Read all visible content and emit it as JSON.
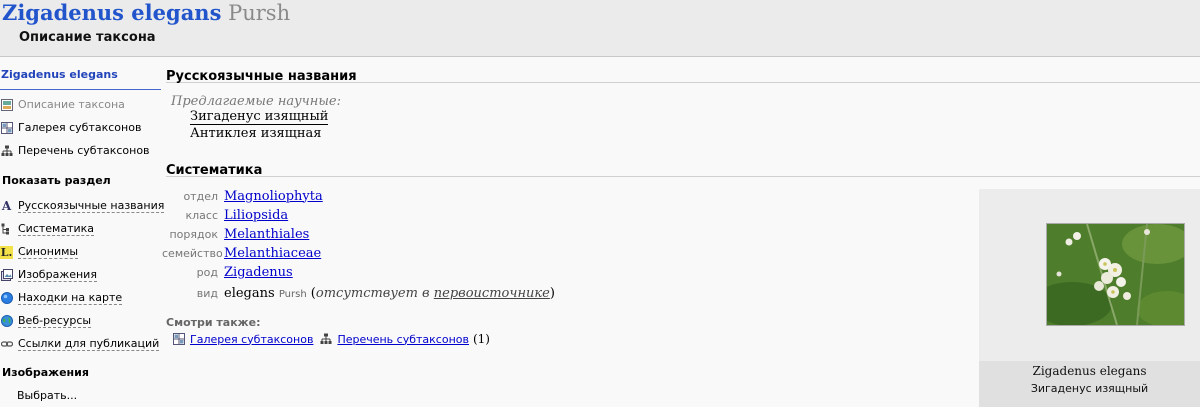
{
  "header": {
    "latin_name": "Zigadenus elegans",
    "author": "Pursh",
    "subtitle": "Описание таксона"
  },
  "sidebar": {
    "taxon_link": "Zigadenus elegans",
    "nav": [
      {
        "label": "Описание таксона",
        "icon": "description-icon"
      },
      {
        "label": "Галерея субтаксонов",
        "icon": "gallery-grid-icon"
      },
      {
        "label": "Перечень субтаксонов",
        "icon": "tree-hierarchy-icon"
      }
    ],
    "show_section_title": "Показать раздел",
    "sections": [
      {
        "label": "Русскоязычные названия",
        "icon": "letter-a-icon"
      },
      {
        "label": "Систематика",
        "icon": "systematics-tree-icon"
      },
      {
        "label": "Синонимы",
        "icon": "letter-l-icon"
      },
      {
        "label": "Изображения",
        "icon": "images-icon"
      },
      {
        "label": "Находки на карте",
        "icon": "globe-blue-icon"
      },
      {
        "label": "Веб-ресурсы",
        "icon": "globe-green-icon"
      },
      {
        "label": "Ссылки для публикаций",
        "icon": "chain-link-icon"
      }
    ],
    "images_title": "Изображения",
    "choose_label": "Выбрать..."
  },
  "main": {
    "russian_names_title": "Русскоязычные названия",
    "proposed_label": "Предлагаемые научные:",
    "russian_names": [
      "Зигаденус изящный",
      "Антиклея изящная"
    ],
    "systematics_title": "Систематика",
    "taxonomy": [
      {
        "rank": "отдел",
        "value": "Magnoliophyta"
      },
      {
        "rank": "класс",
        "value": "Liliopsida"
      },
      {
        "rank": "порядок",
        "value": "Melanthiales"
      },
      {
        "rank": "семейство",
        "value": "Melanthiaceae"
      },
      {
        "rank": "род",
        "value": "Zigadenus"
      }
    ],
    "species": {
      "rank": "вид",
      "epithet": "elegans",
      "author": "Pursh",
      "note_prefix": "отсутствует в",
      "note_link": "первоисточнике"
    },
    "see_also_title": "Смотри также:",
    "see_also": {
      "gallery": "Галерея субтаксонов",
      "list": "Перечень субтаксонов",
      "count": "(1)"
    }
  },
  "photo": {
    "caption_latin": "Zigadenus elegans",
    "caption_russian": "Зигаденус изящный"
  },
  "colors": {
    "link": "#0000cc",
    "title_blue": "#2255cc",
    "header_bg": "#ebebeb"
  }
}
